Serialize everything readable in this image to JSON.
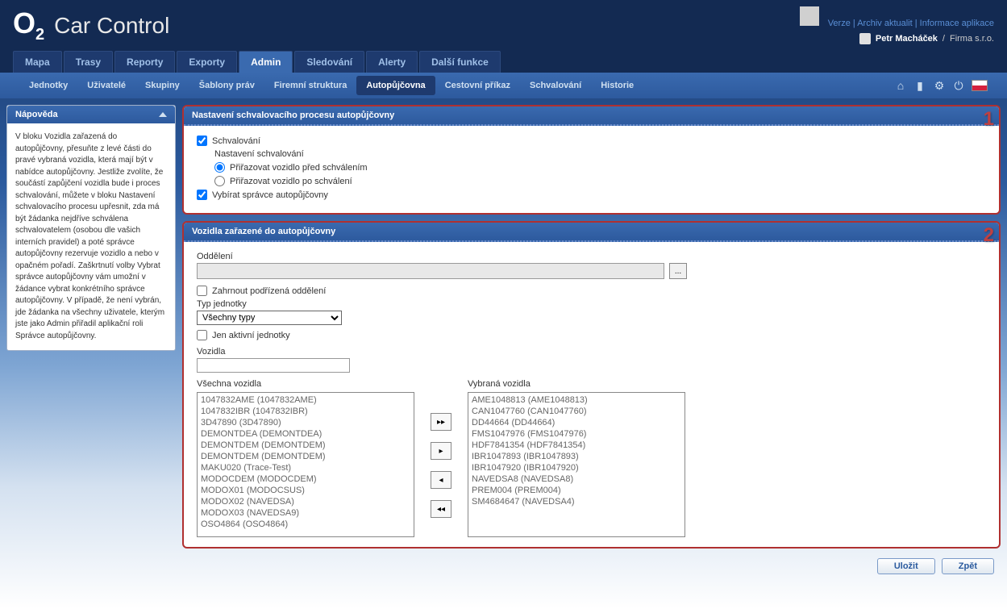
{
  "header": {
    "logo_prefix": "O",
    "logo_suffix": "2",
    "app_title": "Car Control",
    "links": {
      "version": "Verze",
      "archive": "Archiv aktualit",
      "info": "Informace aplikace"
    },
    "user": {
      "name": "Petr Macháček",
      "company": "Firma s.r.o."
    }
  },
  "main_tabs": [
    "Mapa",
    "Trasy",
    "Reporty",
    "Exporty",
    "Admin",
    "Sledování",
    "Alerty",
    "Další funkce"
  ],
  "main_tab_active": 4,
  "sub_tabs": [
    "Jednotky",
    "Uživatelé",
    "Skupiny",
    "Šablony práv",
    "Firemní struktura",
    "Autopůjčovna",
    "Cestovní příkaz",
    "Schvalování",
    "Historie"
  ],
  "sub_tab_active": 5,
  "help": {
    "title": "Nápověda",
    "body": "V bloku Vozidla zařazená do autopůjčovny, přesuňte z levé části do pravé vybraná vozidla, která mají být v nabídce autopůjčovny. Jestliže zvolíte, že součástí zapůjčení vozidla bude i proces schvalování, můžete v bloku Nastavení schvalovacího procesu upřesnit, zda má být žádanka nejdříve schválena schvalovatelem (osobou dle vašich interních pravidel) a poté správce autopůjčovny rezervuje vozidlo a nebo v opačném pořadí. Zaškrtnutí volby Vybrat správce autopůjčovny vám umožní v žádance vybrat konkrétního správce autopůjčovny. V případě, že není vybrán, jde žádanka na všechny uživatele, kterým jste jako Admin přiřadil aplikační roli Správce autopůjčovny."
  },
  "panel1": {
    "title": "Nastavení schvalovacího procesu autopůjčovny",
    "number": "1",
    "approval_label": "Schvalování",
    "settings_label": "Nastavení schvalování",
    "radio_before": "Přiřazovat vozidlo před schválením",
    "radio_after": "Přiřazovat vozidlo po schválení",
    "select_admin_label": "Vybírat správce autopůjčovny"
  },
  "panel2": {
    "title": "Vozidla zařazené do autopůjčovny",
    "number": "2",
    "dept_label": "Oddělení",
    "dept_btn": "...",
    "include_sub_label": "Zahrnout podřízená oddělení",
    "unit_type_label": "Typ jednotky",
    "unit_type_value": "Všechny typy",
    "active_only_label": "Jen aktivní jednotky",
    "vehicles_label": "Vozidla",
    "all_vehicles_label": "Všechna vozidla",
    "selected_vehicles_label": "Vybraná vozidla",
    "all_vehicles": [
      "1047832AME (1047832AME)",
      "1047832IBR (1047832IBR)",
      "3D47890 (3D47890)",
      "DEMONTDEA (DEMONTDEA)",
      "DEMONTDEM (DEMONTDEM)",
      "DEMONTDEM (DEMONTDEM)",
      "MAKU020 (Trace-Test)",
      "MODOCDEM (MODOCDEM)",
      "MODOX01 (MODOCSUS)",
      "MODOX02 (NAVEDSA)",
      "MODOX03 (NAVEDSA9)",
      "OSO4864 (OSO4864)"
    ],
    "selected_vehicles": [
      "AME1048813 (AME1048813)",
      "CAN1047760 (CAN1047760)",
      "DD44664 (DD44664)",
      "FMS1047976 (FMS1047976)",
      "HDF7841354 (HDF7841354)",
      "IBR1047893 (IBR1047893)",
      "IBR1047920 (IBR1047920)",
      "NAVEDSA8 (NAVEDSA8)",
      "PREM004 (PREM004)",
      "SM4684647 (NAVEDSA4)"
    ]
  },
  "buttons": {
    "save": "Uložit",
    "back": "Zpět"
  }
}
